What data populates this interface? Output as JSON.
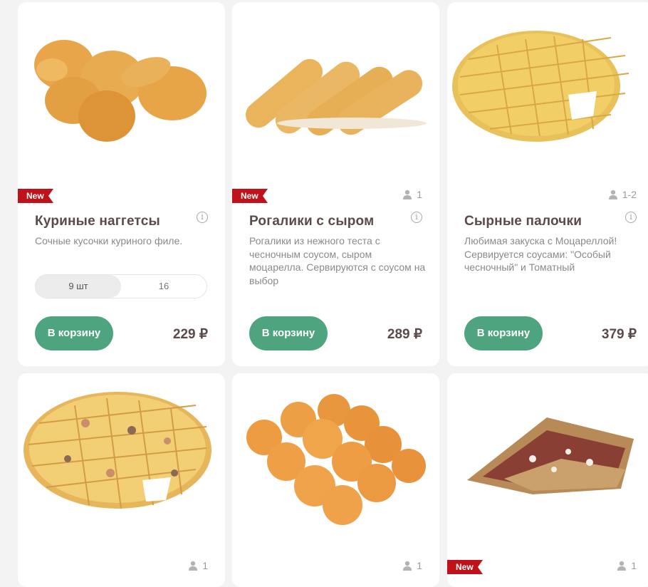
{
  "products": [
    {
      "badge": "New",
      "persons": "",
      "title": "Куриные наггетсы",
      "description": "Сочные кусочки куриного филе.",
      "sizes": [
        "9 шт",
        "16"
      ],
      "cart_label": "В корзину",
      "price": "229 ₽",
      "image_icon": "chicken-nuggets-image"
    },
    {
      "badge": "New",
      "persons": "1",
      "title": "Рогалики с сыром",
      "description": "Рогалики из нежного теста с чесночным соусом, сыром моцарелла. Сервируются с соусом на выбор",
      "cart_label": "В корзину",
      "price": "289 ₽",
      "image_icon": "cheese-rolls-image"
    },
    {
      "badge": "",
      "persons": "1-2",
      "title": "Сырные палочки",
      "description": "Любимая закуска с Моцареллой! Сервируется соусами: \"Особый чесночный\" и Томатный",
      "cart_label": "В корзину",
      "price": "379 ₽",
      "image_icon": "cheese-sticks-image"
    },
    {
      "badge": "",
      "persons": "1",
      "image_icon": "ham-mushroom-sticks-image"
    },
    {
      "badge": "",
      "persons": "1",
      "image_icon": "pastry-rolls-image"
    },
    {
      "badge": "New",
      "persons": "1",
      "image_icon": "meat-quesadilla-image"
    }
  ],
  "colors": {
    "badge": "#c0121b",
    "button": "#4ea47f",
    "title": "#5b4a4a"
  }
}
